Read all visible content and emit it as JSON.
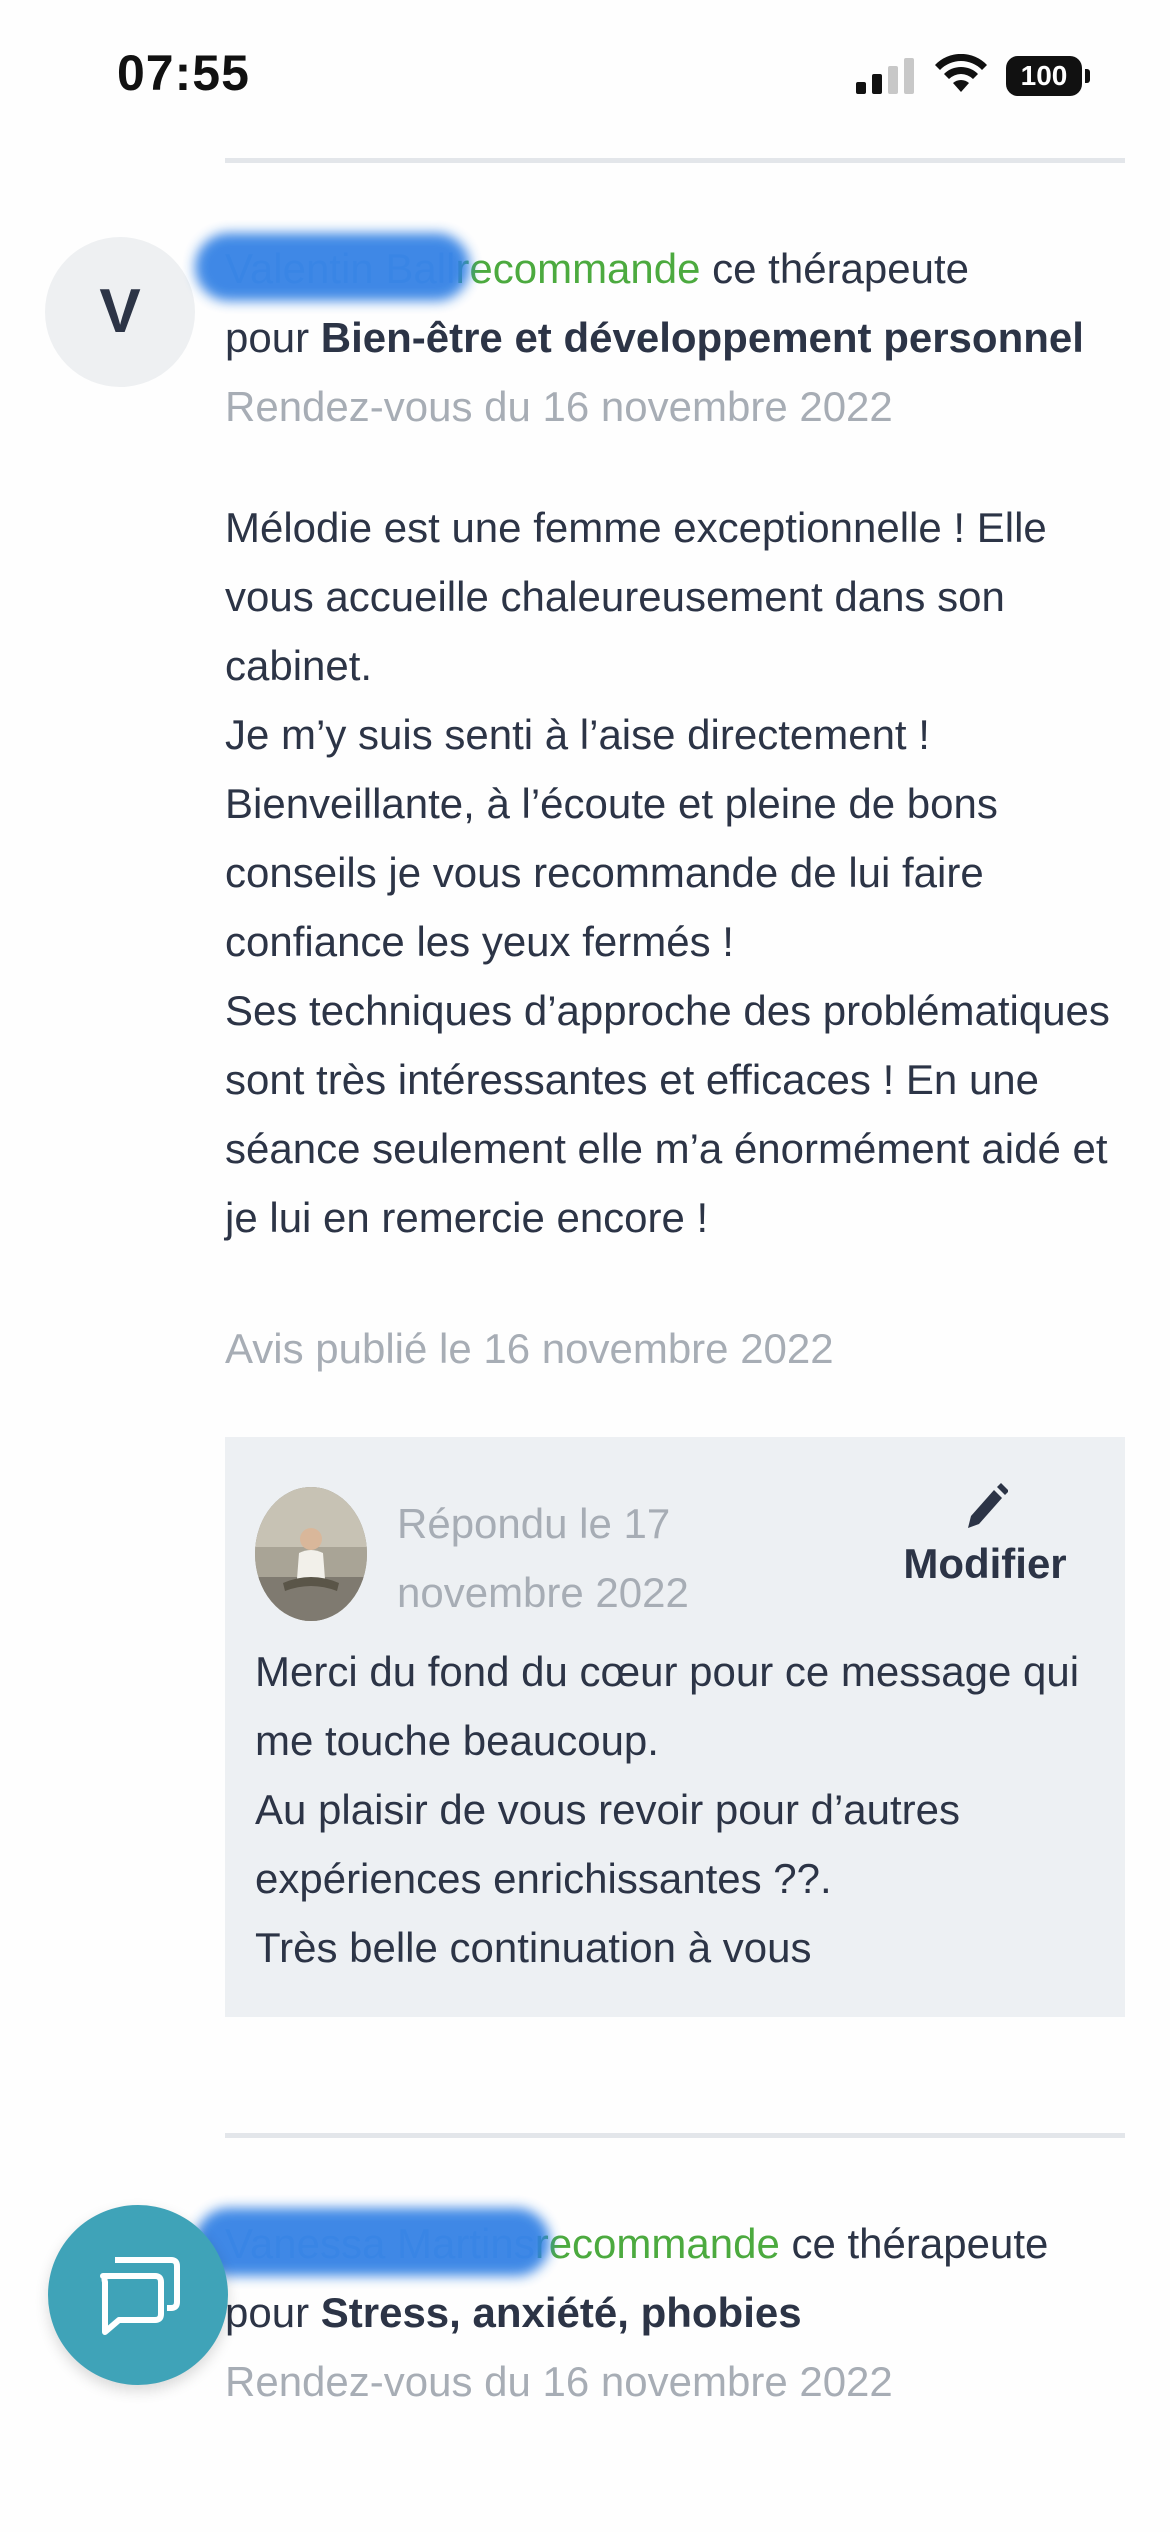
{
  "status_bar": {
    "time": "07:55",
    "battery": "100"
  },
  "reviews": [
    {
      "avatar_letter": "V",
      "author_redacted": "Valentin Ball",
      "recommends": "recommande",
      "tail": " ce thérapeute",
      "for_prefix": "pour ",
      "category": "Bien-être et développement personnel",
      "appointment": "Rendez-vous du 16 novembre 2022",
      "body": [
        "Mélodie est une femme exceptionnelle ! Elle vous accueille chaleureusement dans son cabinet.",
        "Je m’y suis senti à l’aise directement ! Bienveillante, à l’écoute et pleine de bons conseils je vous recommande de lui faire confiance les yeux fermés !",
        "Ses techniques d’approche des problématiques sont très intéressantes et efficaces ! En une séance seulement elle m’a énormément aidé et je lui en remercie encore !"
      ],
      "published": "Avis publié le 16 novembre 2022",
      "reply": {
        "date": "Répondu le 17 novembre 2022",
        "edit_label": "Modifier",
        "body": [
          "Merci du fond du cœur pour ce message qui me touche beaucoup.",
          "Au plaisir de vous revoir pour d’autres expériences enrichissantes ??.",
          "Très belle continuation à vous"
        ]
      }
    },
    {
      "author_redacted": "Vanessa Martins",
      "recommends": "recommande",
      "tail": " ce thérapeute",
      "for_prefix": "pour ",
      "category": "Stress, anxiété, phobies",
      "appointment": "Rendez-vous du 16 novembre 2022"
    }
  ],
  "icons": {
    "edit": "pencil-icon",
    "chat": "chat-bubbles-icon"
  },
  "colors": {
    "accent_green": "#4caa3f",
    "fab": "#3fa3b8",
    "reply_bg": "#edf0f3"
  }
}
